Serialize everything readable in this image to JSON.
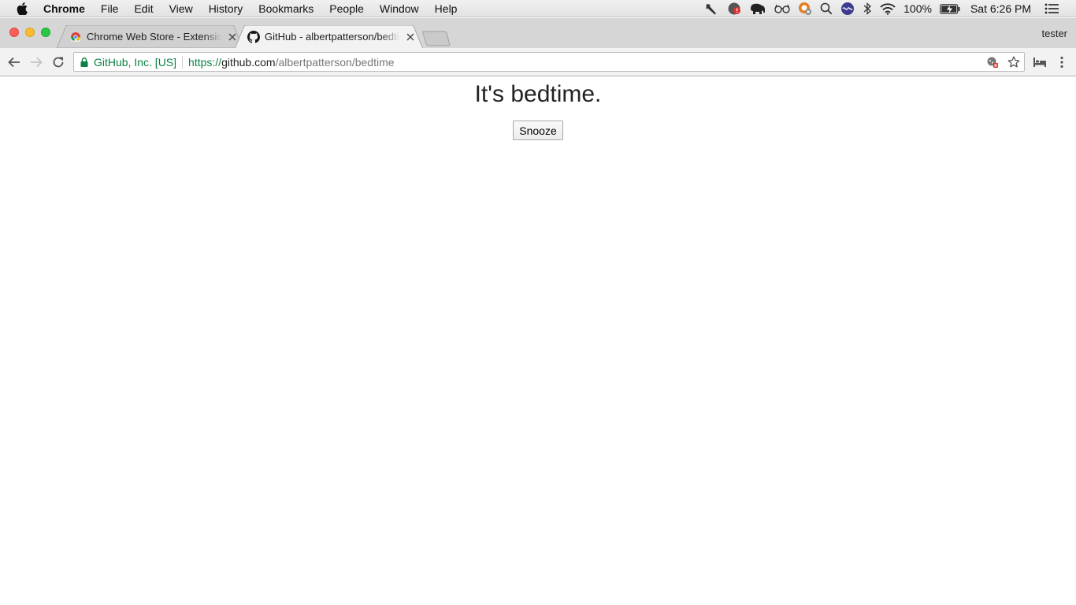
{
  "menubar": {
    "app_name": "Chrome",
    "items": [
      "File",
      "Edit",
      "View",
      "History",
      "Bookmarks",
      "People",
      "Window",
      "Help"
    ],
    "battery": "100%",
    "clock": "Sat 6:26 PM"
  },
  "tabs": [
    {
      "title": "Chrome Web Store - Extensions",
      "favicon": "chrome-web-store-icon",
      "active": false
    },
    {
      "title": "GitHub - albertpatterson/bedtime",
      "favicon": "github-icon",
      "active": true
    }
  ],
  "profile_name": "tester",
  "omnibox": {
    "security_label": "GitHub, Inc. [US]",
    "url_scheme": "https://",
    "url_host": "github.com",
    "url_path": "/albertpatterson/bedtime"
  },
  "page": {
    "heading": "It's bedtime.",
    "snooze_label": "Snooze"
  },
  "colors": {
    "secure_green": "#0b8043",
    "close": "#fc5f57",
    "minimize": "#fdbc2e",
    "maximize": "#28c840"
  }
}
